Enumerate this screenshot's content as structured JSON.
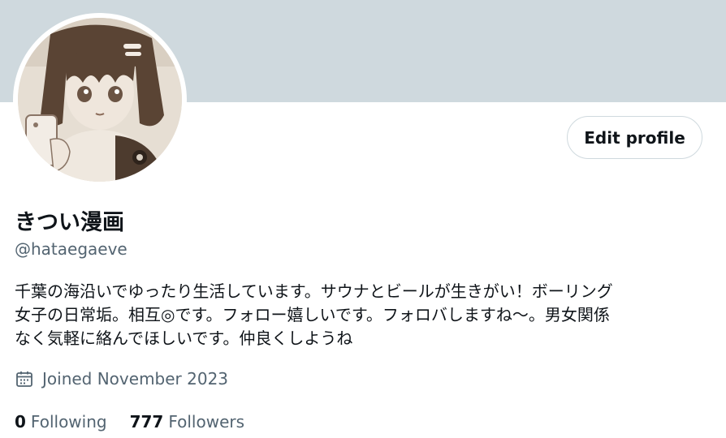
{
  "profile": {
    "display_name": "きつい漫画",
    "handle": "@hataegaeve",
    "bio": "千葉の海沿いでゆったり生活しています。サウナとビールが生きがい！ボーリング\n女子の日常垢。相互◎です。フォロー嬉しいです。フォロバしますね〜。男女関係\nなく気軽に絡んでほしいです。仲良くしようね",
    "joined": "Joined November 2023",
    "edit_label": "Edit profile",
    "joined_icon": "calendar-icon"
  },
  "stats": {
    "following_count": "0",
    "following_label": "Following",
    "followers_count": "777",
    "followers_label": "Followers"
  },
  "colors": {
    "banner": "#cfd9de",
    "text_primary": "#0f1419",
    "text_secondary": "#536471",
    "button_border": "#cfd9de"
  }
}
